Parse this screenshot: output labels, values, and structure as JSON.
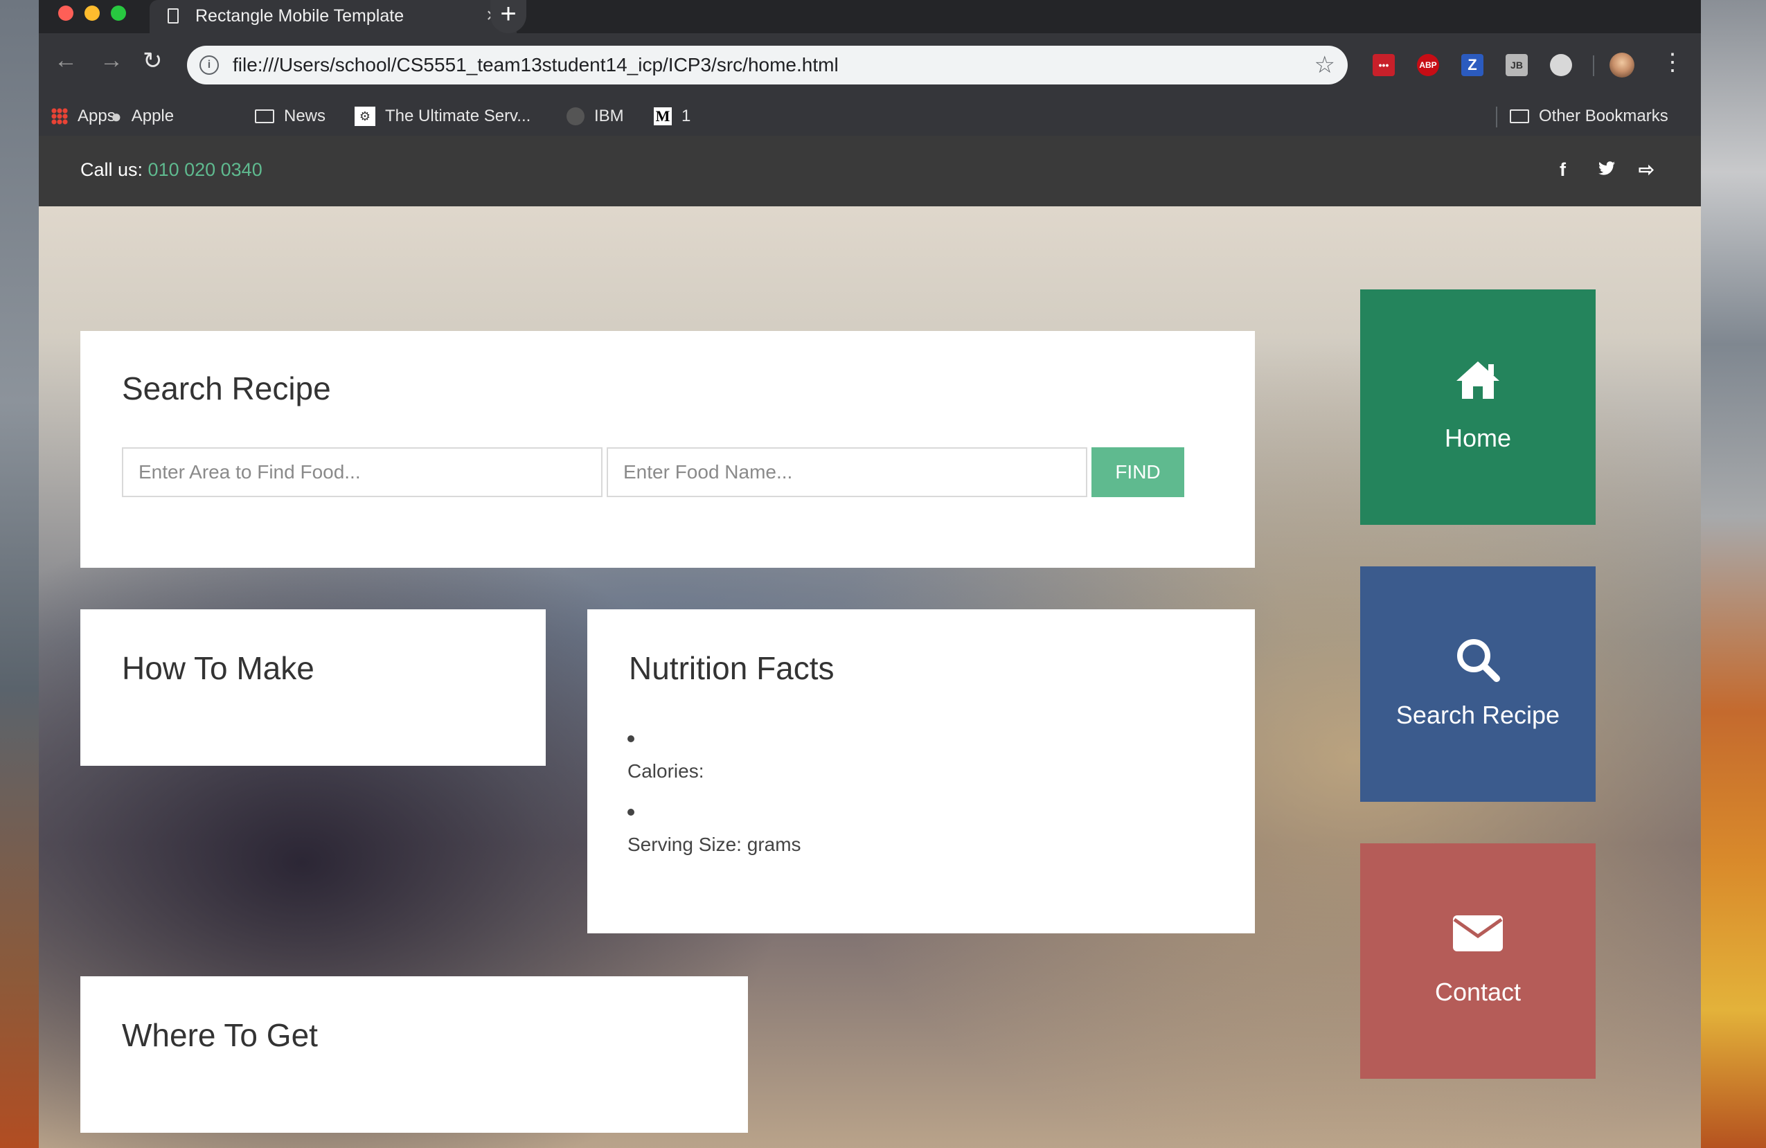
{
  "browser": {
    "tab_title": "Rectangle Mobile Template",
    "tab_close": "×",
    "new_tab": "+",
    "url": "file:///Users/school/CS5551_team13student14_icp/ICP3/src/home.html",
    "bookmarks": [
      "Apps",
      "Apple",
      "News",
      "The Ultimate Serv...",
      "IBM",
      "1"
    ],
    "other_bookmarks": "Other Bookmarks",
    "extensions": [
      "•••",
      "ABP",
      "Z",
      "JB",
      ""
    ]
  },
  "topbar": {
    "call_label": "Call us: ",
    "phone": "010 020 0340",
    "social": [
      "f",
      "t",
      "⇨"
    ]
  },
  "search_card": {
    "title": "Search Recipe",
    "area_placeholder": "Enter Area to Find Food...",
    "food_placeholder": "Enter Food Name...",
    "find_label": "FIND"
  },
  "howto_card": {
    "title": "How To Make"
  },
  "nutrition_card": {
    "title": "Nutrition Facts",
    "calories_label": "Calories:",
    "serving_label": "Serving Size: grams"
  },
  "where_card": {
    "title": "Where To Get"
  },
  "tiles": {
    "home": "Home",
    "search": "Search Recipe",
    "contact": "Contact"
  },
  "colors": {
    "accent_green": "#5fba8f",
    "tile_home": "#24845c",
    "tile_search": "#3b5b8d",
    "tile_contact": "#b55c58",
    "topbar": "#3a3a3a"
  },
  "icons": {
    "home": "home-icon",
    "search": "search-icon",
    "contact": "envelope-icon"
  }
}
